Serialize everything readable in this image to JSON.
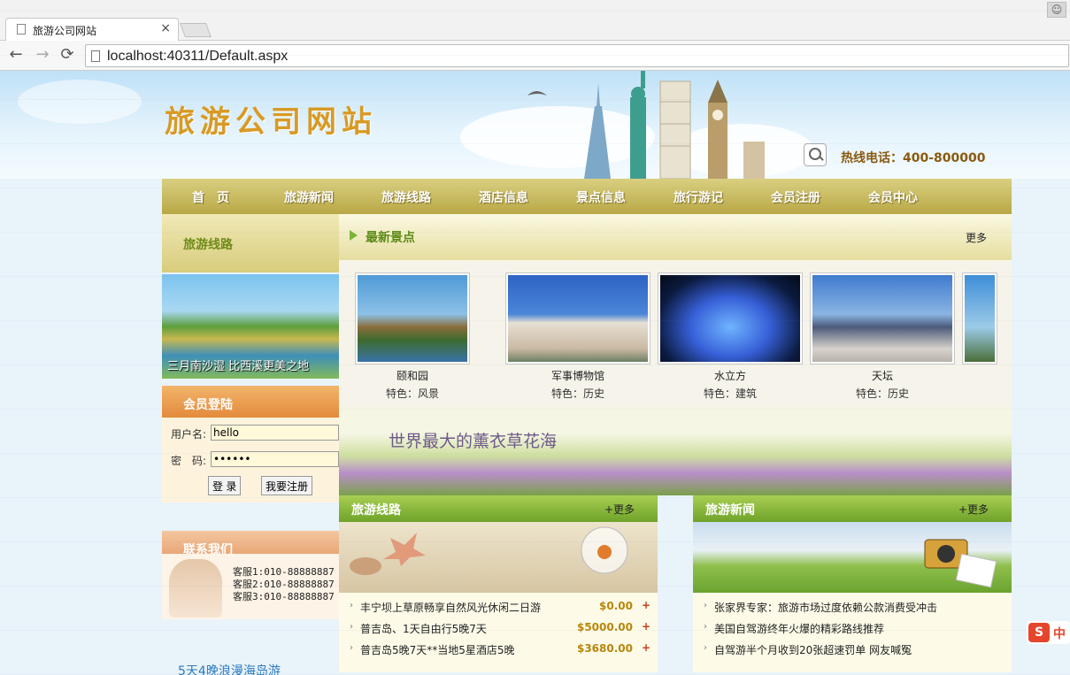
{
  "browser": {
    "tab_title": "旅游公司网站",
    "tab_close": "×",
    "url": "localhost:40311/Default.aspx",
    "back": "←",
    "forward": "→",
    "reload": "⟳",
    "user_icon": "person-icon"
  },
  "header": {
    "site_title": "旅游公司网站",
    "hotline": "热线电话：400-800000"
  },
  "nav": {
    "items": [
      "首　页",
      "旅游新闻",
      "旅游线路",
      "酒店信息",
      "景点信息",
      "旅行游记",
      "会员注册",
      "会员中心"
    ]
  },
  "left": {
    "route_header": "旅游线路",
    "route_caption": "三月南沙湿  比西溪更美之地",
    "member_header": "会员登陆",
    "username_label": "用户名:",
    "username_value": "hello",
    "password_label": "密　码:",
    "password_value": "••••••",
    "login_button": "登 录",
    "register_button": "我要注册",
    "contact_header": "联系我们",
    "contacts": [
      "客服1:010-88888887",
      "客服2:010-88888887",
      "客服3:010-88888887"
    ],
    "bottom_link": "5天4晚浪漫海岛游"
  },
  "latest": {
    "header": "最新景点",
    "more": "更多",
    "items": [
      {
        "name": "颐和园",
        "feature": "特色：风景"
      },
      {
        "name": "军事博物馆",
        "feature": "特色：历史"
      },
      {
        "name": "水立方",
        "feature": "特色：建筑"
      },
      {
        "name": "天坛",
        "feature": "特色：历史"
      }
    ]
  },
  "banner2": {
    "text": "世界最大的薰衣草花海"
  },
  "routes": {
    "header": "旅游线路",
    "more": "+更多",
    "rows": [
      {
        "title": "丰宁坝上草原畅享自然风光休闲二日游",
        "price": "$0.00",
        "plus": "+"
      },
      {
        "title": "普吉岛、1天自由行5晚7天",
        "price": "$5000.00",
        "plus": "+"
      },
      {
        "title": "普吉岛5晚7天**当地5星酒店5晚",
        "price": "$3680.00",
        "plus": "+"
      }
    ]
  },
  "news": {
    "header": "旅游新闻",
    "more": "+更多",
    "rows": [
      {
        "title": "张家界专家：旅游市场过度依赖公款消费受冲击"
      },
      {
        "title": "美国自驾游终年火爆的精彩路线推荐"
      },
      {
        "title": "自驾游半个月收到20张超速罚单 网友喊冤"
      }
    ]
  },
  "badge": {
    "s": "S",
    "z": "中"
  },
  "colors": {
    "nav_gold": "#b9a846",
    "green_header": "#6fa22a",
    "title_orange": "#d89a24"
  }
}
